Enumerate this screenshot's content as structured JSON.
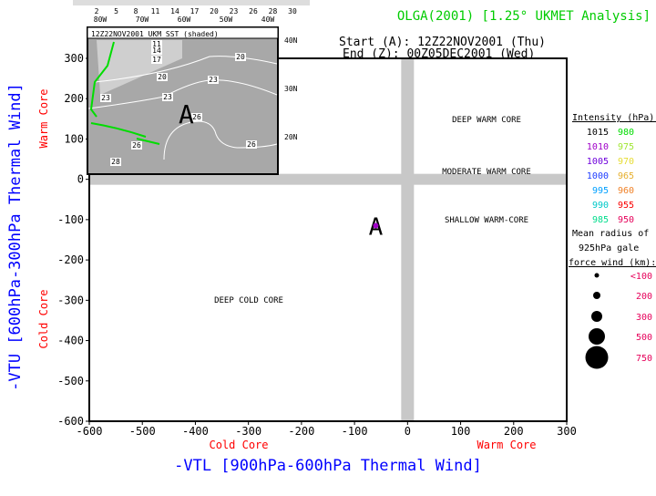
{
  "header": {
    "title": "OLGA(2001) [1.25° UKMET Analysis]",
    "start": "Start (A): 12Z22NOV2001 (Thu)",
    "end": "End (Z): 00Z05DEC2001 (Wed)",
    "title_color": "#00cc00"
  },
  "inset": {
    "label": "12Z22NOV2001 UKM SST (shaded)",
    "colorbar_ticks": [
      "2",
      "5",
      "8",
      "11",
      "14",
      "17",
      "20",
      "23",
      "26",
      "28",
      "30"
    ],
    "lon_labels": [
      "80W",
      "70W",
      "60W",
      "50W",
      "40W"
    ],
    "lat_labels": [
      "40N",
      "30N",
      "20N"
    ],
    "contour_labels": [
      "11",
      "14",
      "17",
      "20",
      "20",
      "23",
      "23",
      "23",
      "26",
      "26",
      "26",
      "28"
    ],
    "marker": "A"
  },
  "chart_data": {
    "type": "scatter",
    "title": "OLGA(2001) [1.25° UKMET Analysis]",
    "xlabel": "-VTL [900hPa-600hPa Thermal Wind]",
    "ylabel": "-VTU [600hPa-300hPa Thermal Wind]",
    "xlim": [
      -600,
      300
    ],
    "ylim": [
      -600,
      300
    ],
    "xticks": [
      -600,
      -500,
      -400,
      -300,
      -200,
      -100,
      0,
      100,
      200,
      300
    ],
    "yticks": [
      300,
      200,
      100,
      0,
      -100,
      -200,
      -300,
      -400,
      -500,
      -600
    ],
    "x_side_labels": {
      "left": "Cold Core",
      "right": "Warm Core"
    },
    "y_side_labels": {
      "top": "Warm Core",
      "bottom": "Cold Core"
    },
    "side_label_color": "#ff0000",
    "axis_label_color": "#0000ff",
    "regions": [
      "DEEP WARM CORE",
      "MODERATE WARM CORE",
      "SHALLOW WARM-CORE",
      "DEEP COLD CORE"
    ],
    "points": [
      {
        "label": "A",
        "x": -60,
        "y": -115,
        "intensity_hpa": 1010,
        "color": "#a000c8"
      }
    ]
  },
  "legend": {
    "intensity_title": "Intensity (hPa):",
    "intensity": [
      {
        "value": "1015",
        "color": "#000000"
      },
      {
        "value": "980",
        "color": "#00dc00"
      },
      {
        "value": "1010",
        "color": "#a000c8"
      },
      {
        "value": "975",
        "color": "#a0e632"
      },
      {
        "value": "1005",
        "color": "#6e00dc"
      },
      {
        "value": "970",
        "color": "#e6dc32"
      },
      {
        "value": "1000",
        "color": "#1e3cff"
      },
      {
        "value": "965",
        "color": "#e6af2d"
      },
      {
        "value": "995",
        "color": "#00a0ff"
      },
      {
        "value": "960",
        "color": "#f08228"
      },
      {
        "value": "990",
        "color": "#00c8c8"
      },
      {
        "value": "955",
        "color": "#fa0000"
      },
      {
        "value": "985",
        "color": "#00dc8c"
      },
      {
        "value": "950",
        "color": "#e6005a"
      }
    ],
    "radius_title_1": "Mean radius of",
    "radius_title_2": "925hPa gale",
    "radius_title_3": "force wind (km):",
    "radius": [
      {
        "label": "<100",
        "size": 100
      },
      {
        "label": "200",
        "size": 200
      },
      {
        "label": "300",
        "size": 300
      },
      {
        "label": "500",
        "size": 500
      },
      {
        "label": "750",
        "size": 750
      }
    ],
    "radius_color": "#e6005a"
  }
}
